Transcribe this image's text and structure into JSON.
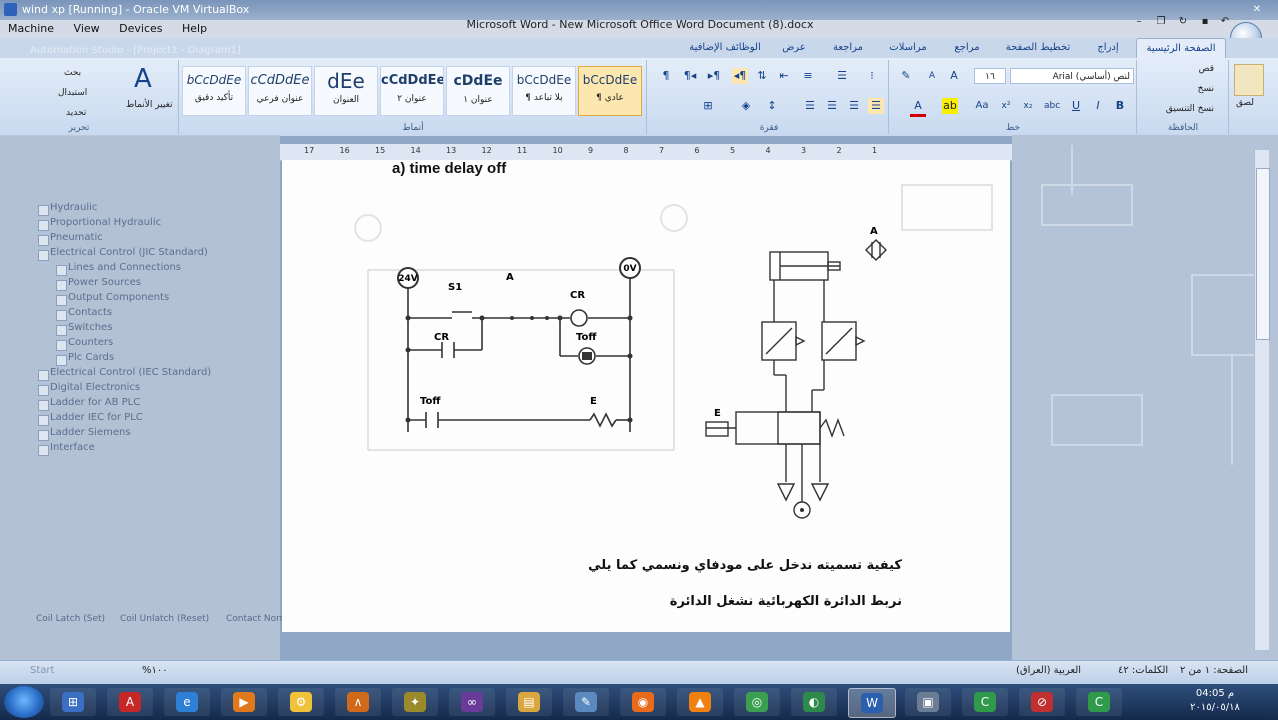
{
  "vbox": {
    "title": "wind xp [Running] - Oracle VM VirtualBox",
    "menu": [
      "Machine",
      "View",
      "Devices",
      "Help"
    ]
  },
  "word": {
    "title": "Microsoft Word - New Microsoft Office Word Document (8).docx",
    "tabs": [
      "الصفحة الرئيسية",
      "إدراج",
      "تخطيط الصفحة",
      "مراجع",
      "مراسلات",
      "مراجعة",
      "عرض",
      "الوظائف الإضافية"
    ],
    "active_tab": "الصفحة الرئيسية",
    "clipboard": {
      "paste": "لصق",
      "cut": "قص",
      "copy": "نسخ",
      "format_painter": "نسخ التنسيق",
      "label": "الحافظة"
    },
    "font": {
      "name": "Arial (أساسي) لنص",
      "size": "١٦",
      "label": "خط"
    },
    "paragraph_label": "فقرة",
    "styles": [
      {
        "sample": "bCcDdEe",
        "name": "¶ عادي"
      },
      {
        "sample": "bCcDdEe",
        "name": "¶ بلا تباعد"
      },
      {
        "sample": "cDdEe",
        "name": "عنوان ١"
      },
      {
        "sample": "cCdDdEe",
        "name": "عنوان ٢"
      },
      {
        "sample": "dEe",
        "name": "العنوان"
      },
      {
        "sample": "cCdDdEe",
        "name": "عنوان فرعي"
      },
      {
        "sample": "bCcDdEe",
        "name": "تأكيد دقيق"
      }
    ],
    "styles_label": "أنماط",
    "change_styles": "تغيير الأنماط",
    "editing": {
      "find": "بحث",
      "replace": "استبدال",
      "select": "تحديد",
      "label": "تحرير"
    }
  },
  "ghost_tree": [
    {
      "label": "Hydraulic",
      "level": 0
    },
    {
      "label": "Proportional Hydraulic",
      "level": 0
    },
    {
      "label": "Pneumatic",
      "level": 0
    },
    {
      "label": "Electrical Control (JIC Standard)",
      "level": 0
    },
    {
      "label": "Lines and Connections",
      "level": 1
    },
    {
      "label": "Power Sources",
      "level": 1
    },
    {
      "label": "Output Components",
      "level": 1
    },
    {
      "label": "Contacts",
      "level": 1
    },
    {
      "label": "Switches",
      "level": 1
    },
    {
      "label": "Counters",
      "level": 1
    },
    {
      "label": "Plc Cards",
      "level": 1
    },
    {
      "label": "Electrical Control (IEC Standard)",
      "level": 0
    },
    {
      "label": "Digital Electronics",
      "level": 0
    },
    {
      "label": "Ladder for AB PLC",
      "level": 0
    },
    {
      "label": "Ladder IEC for PLC",
      "level": 0
    },
    {
      "label": "Ladder Siemens",
      "level": 0
    },
    {
      "label": "Interface",
      "level": 0
    }
  ],
  "ghost_bottom": [
    "Coil Latch (Set)",
    "Coil Unlatch (Reset)",
    "Contact Normally Open"
  ],
  "ghost_header": "Automation Studio - [Project1 - Diagram1]",
  "ruler": [
    "17",
    "16",
    "15",
    "14",
    "13",
    "12",
    "11",
    "10",
    "9",
    "8",
    "7",
    "6",
    "5",
    "4",
    "3",
    "2",
    "1"
  ],
  "document": {
    "heading": "a)  time delay off",
    "circuit_labels": {
      "v24": "24V",
      "v0": "0V",
      "s1": "S1",
      "a": "A",
      "cr": "CR",
      "toff": "Toff",
      "e": "E"
    },
    "pneumatic_labels": {
      "a": "A",
      "e": "E"
    },
    "arabic_line1": "كيفية تسميته  ندخل على مودفاي ونسمي كما يلي",
    "arabic_line2": "نربط الدائرة الكهربائية نشغل الدائرة"
  },
  "status": {
    "page": "الصفحة: ١ من ٢",
    "words": "الكلمات: ٤٢",
    "language": "العربية (العراق)",
    "zoom": "١٠٠%"
  },
  "ghost_status": "Start",
  "taskbar": {
    "apps": [
      "windows-explorer",
      "acrobat",
      "internet-explorer",
      "media-player",
      "automation-studio",
      "matlab",
      "cheat",
      "visual-studio",
      "file-explorer",
      "notepad",
      "firefox",
      "vlc",
      "chrome",
      "network",
      "word",
      "virtualbox",
      "camtasia",
      "blocked",
      "camtasia-recorder"
    ],
    "time": "04:05 م",
    "date": "٢٠١٥/٠٥/١٨"
  }
}
